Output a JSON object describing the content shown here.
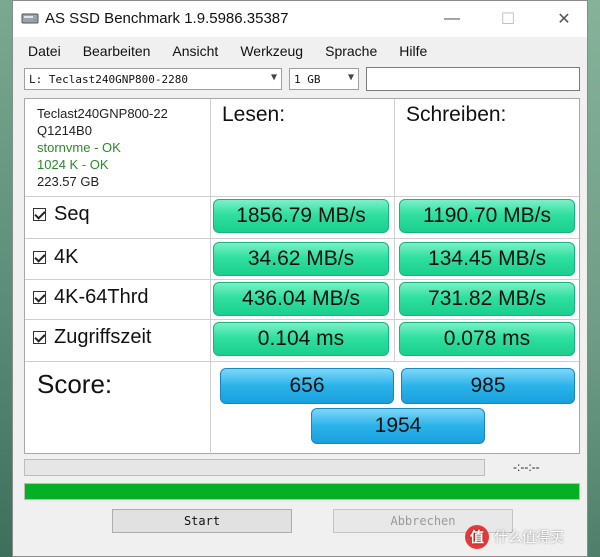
{
  "window": {
    "title": "AS SSD Benchmark 1.9.5986.35387",
    "controls": {
      "minimize": "—",
      "maximize": "☐",
      "close": "✕"
    }
  },
  "menu": [
    "Datei",
    "Bearbeiten",
    "Ansicht",
    "Werkzeug",
    "Sprache",
    "Hilfe"
  ],
  "toolbar": {
    "drive_select": "L: Teclast240GNP800-2280",
    "size_select": "1 GB",
    "search_value": ""
  },
  "drive_info": {
    "model": "Teclast240GNP800-22",
    "firmware": "Q1214B0",
    "driver_status": "stornvme - OK",
    "alignment_status": "1024 K - OK",
    "capacity": "223.57 GB"
  },
  "columns": {
    "read": "Lesen:",
    "write": "Schreiben:"
  },
  "tests": [
    {
      "label": "Seq",
      "read": "1856.79 MB/s",
      "write": "1190.70 MB/s"
    },
    {
      "label": "4K",
      "read": "34.62 MB/s",
      "write": "134.45 MB/s"
    },
    {
      "label": "4K-64Thrd",
      "read": "436.04 MB/s",
      "write": "731.82 MB/s"
    },
    {
      "label": "Zugriffszeit",
      "read": "0.104 ms",
      "write": "0.078 ms"
    }
  ],
  "score": {
    "label": "Score:",
    "read": "656",
    "write": "985",
    "total": "1954"
  },
  "progress": {
    "current_fraction": 0.0,
    "time": "-:--:--",
    "total_fraction": 1.0
  },
  "buttons": {
    "start": "Start",
    "abort": "Abbrechen"
  },
  "watermark": {
    "badge": "值",
    "text": "什么值得买"
  },
  "colors": {
    "result_green": "#2fe0a0",
    "score_blue": "#2ab3ea",
    "progress_green": "#06b025",
    "ok_text": "#2a8a2a"
  }
}
